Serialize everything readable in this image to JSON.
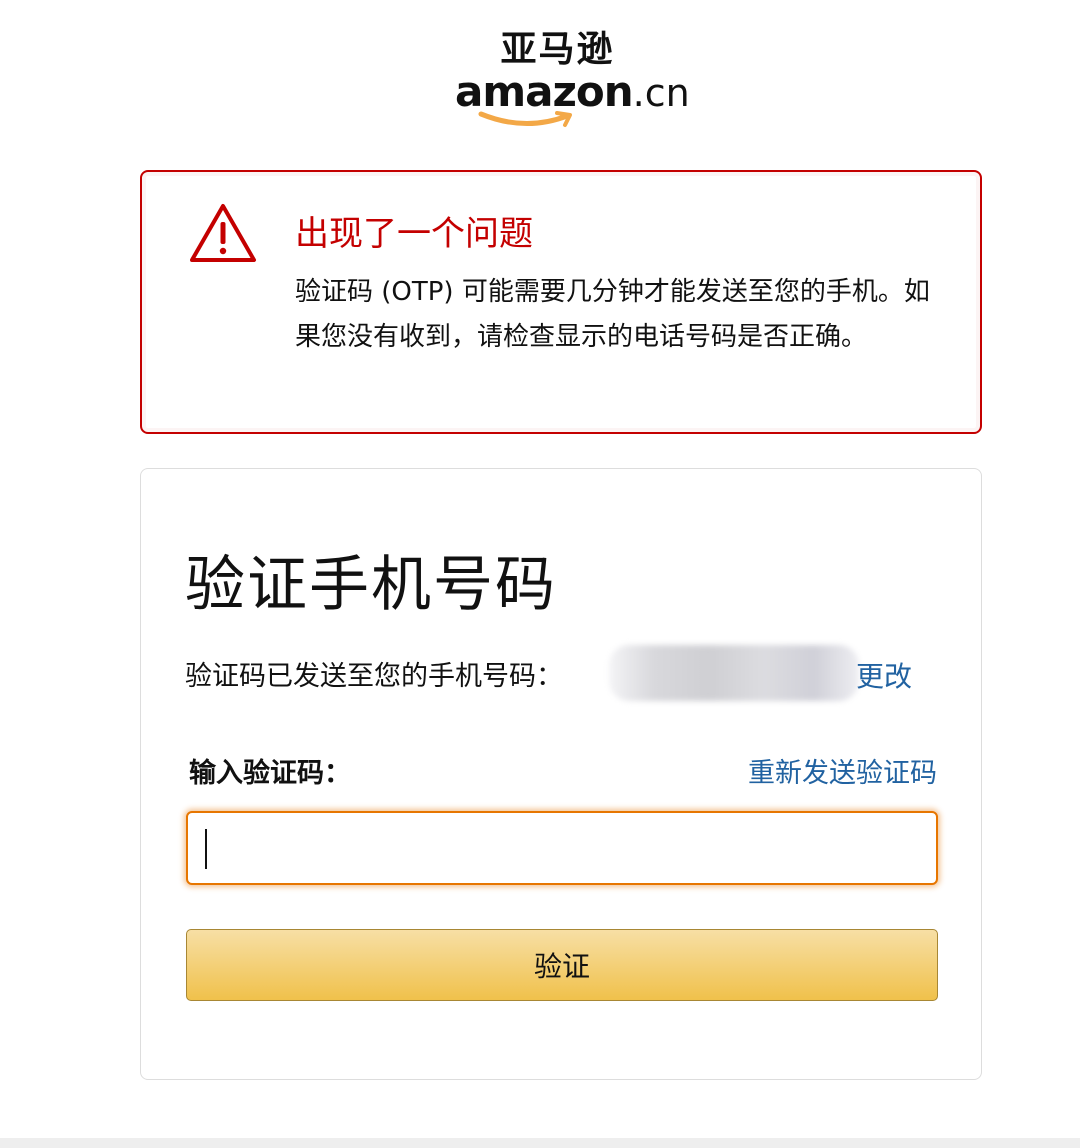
{
  "logo": {
    "cn_text": "亚马逊",
    "en_text": "amazon",
    "domain_suffix": ".cn",
    "smile_color": "#f3a847"
  },
  "alert": {
    "title": "出现了一个问题",
    "message": "验证码 (OTP) 可能需要几分钟才能发送至您的手机。如果您没有收到，请检查显示的电话号码是否正确。",
    "icon": "warning-triangle-icon",
    "color": "#c40000"
  },
  "verify": {
    "title": "验证手机号码",
    "sent_text": "验证码已发送至您的手机号码：",
    "change_link": "更改",
    "otp_label": "输入验证码：",
    "resend_link": "重新发送验证码",
    "otp_value": "",
    "button_label": "验证",
    "link_color": "#2162a1",
    "button_color": "#f0c14b"
  }
}
